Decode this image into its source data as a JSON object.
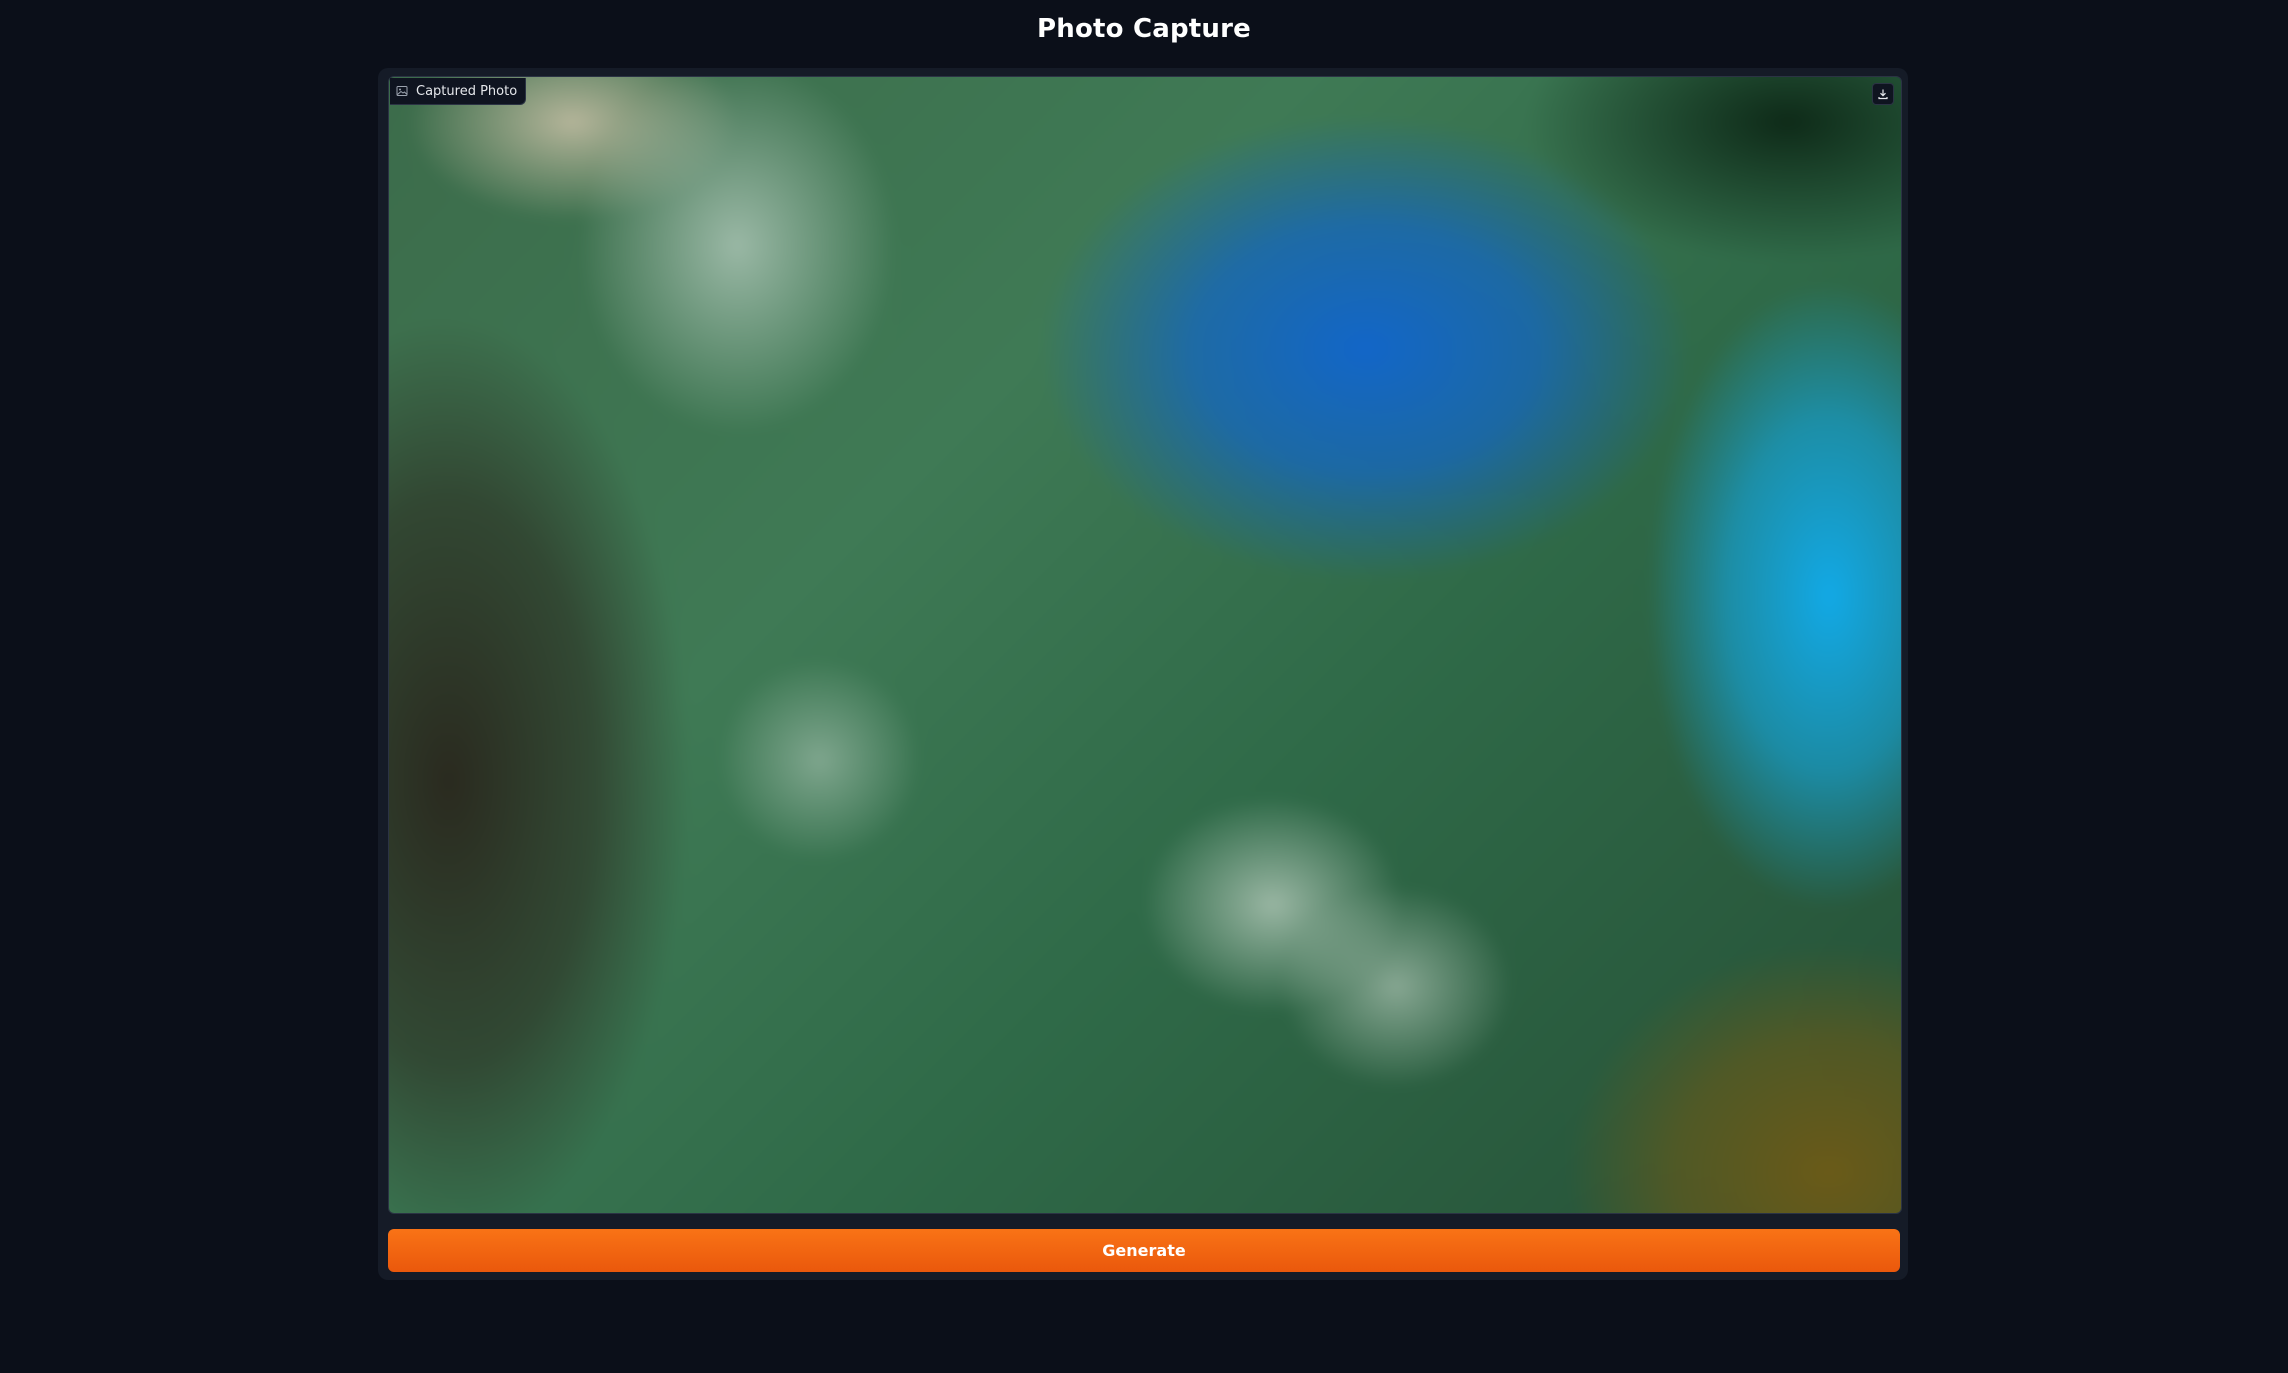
{
  "page": {
    "title": "Photo Capture"
  },
  "image_panel": {
    "label": "Captured Photo",
    "label_icon": "image-icon",
    "download_icon": "download-icon"
  },
  "actions": {
    "generate_label": "Generate"
  },
  "colors": {
    "background": "#0b0f19",
    "panel": "#151b27",
    "accent": "#f97316"
  }
}
